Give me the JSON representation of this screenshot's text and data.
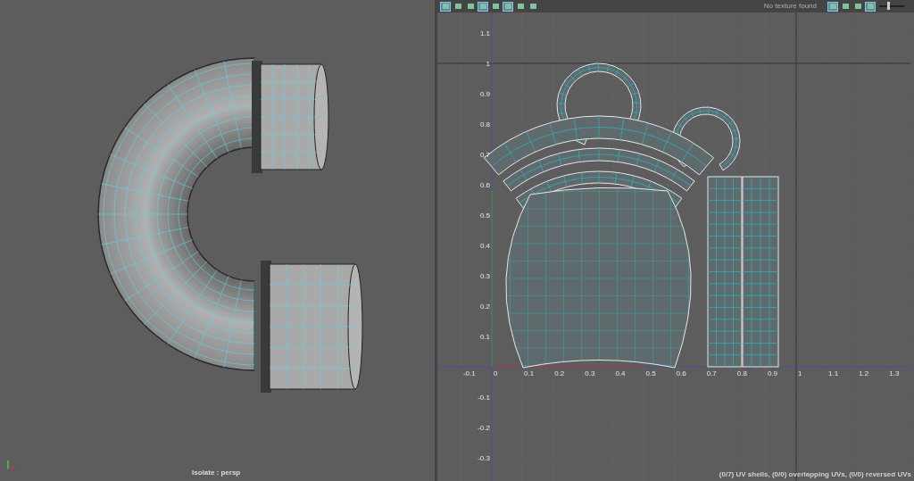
{
  "viewport": {
    "label": "Isolate : persp"
  },
  "uv_editor": {
    "toolbar": {
      "left_tools": [
        {
          "selected": true
        },
        {
          "selected": false
        },
        {
          "selected": false
        },
        {
          "selected": true
        },
        {
          "selected": false
        },
        {
          "selected": true
        },
        {
          "selected": false
        },
        {
          "selected": false
        }
      ],
      "texture_status": "No texture found",
      "right_tools": [
        {
          "selected": true
        },
        {
          "selected": false
        },
        {
          "selected": false
        },
        {
          "selected": true
        }
      ],
      "slider": {
        "level": 0.33
      }
    },
    "u_labels": [
      "-0.1",
      "0",
      "0.1",
      "0.2",
      "0.3",
      "0.4",
      "0.5",
      "0.6",
      "0.7",
      "0.8",
      "0.9",
      "1",
      "1.1",
      "1.2",
      "1.3"
    ],
    "v_labels": [
      "1.1",
      "1",
      "0.9",
      "0.8",
      "0.7",
      "0.6",
      "0.5",
      "0.4",
      "0.3",
      "0.2",
      "0.1",
      "-0.1",
      "-0.2",
      "-0.3"
    ],
    "status": "(0/7) UV shells, (0/0) overlapping UVs, (0/0) reversed UVs"
  }
}
